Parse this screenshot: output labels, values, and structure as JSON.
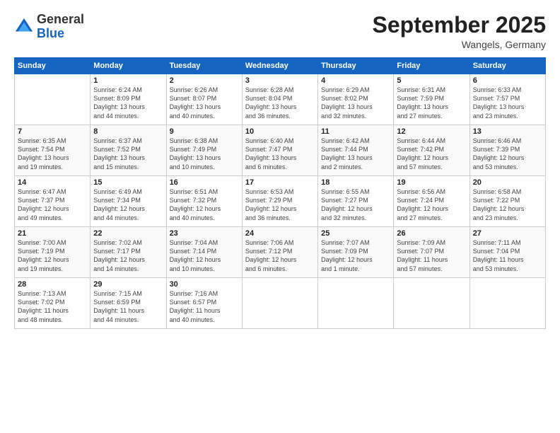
{
  "logo": {
    "line1": "General",
    "line2": "Blue"
  },
  "header": {
    "month": "September 2025",
    "location": "Wangels, Germany"
  },
  "days_of_week": [
    "Sunday",
    "Monday",
    "Tuesday",
    "Wednesday",
    "Thursday",
    "Friday",
    "Saturday"
  ],
  "weeks": [
    [
      {
        "day": "",
        "info": ""
      },
      {
        "day": "1",
        "info": "Sunrise: 6:24 AM\nSunset: 8:09 PM\nDaylight: 13 hours\nand 44 minutes."
      },
      {
        "day": "2",
        "info": "Sunrise: 6:26 AM\nSunset: 8:07 PM\nDaylight: 13 hours\nand 40 minutes."
      },
      {
        "day": "3",
        "info": "Sunrise: 6:28 AM\nSunset: 8:04 PM\nDaylight: 13 hours\nand 36 minutes."
      },
      {
        "day": "4",
        "info": "Sunrise: 6:29 AM\nSunset: 8:02 PM\nDaylight: 13 hours\nand 32 minutes."
      },
      {
        "day": "5",
        "info": "Sunrise: 6:31 AM\nSunset: 7:59 PM\nDaylight: 13 hours\nand 27 minutes."
      },
      {
        "day": "6",
        "info": "Sunrise: 6:33 AM\nSunset: 7:57 PM\nDaylight: 13 hours\nand 23 minutes."
      }
    ],
    [
      {
        "day": "7",
        "info": "Sunrise: 6:35 AM\nSunset: 7:54 PM\nDaylight: 13 hours\nand 19 minutes."
      },
      {
        "day": "8",
        "info": "Sunrise: 6:37 AM\nSunset: 7:52 PM\nDaylight: 13 hours\nand 15 minutes."
      },
      {
        "day": "9",
        "info": "Sunrise: 6:38 AM\nSunset: 7:49 PM\nDaylight: 13 hours\nand 10 minutes."
      },
      {
        "day": "10",
        "info": "Sunrise: 6:40 AM\nSunset: 7:47 PM\nDaylight: 13 hours\nand 6 minutes."
      },
      {
        "day": "11",
        "info": "Sunrise: 6:42 AM\nSunset: 7:44 PM\nDaylight: 13 hours\nand 2 minutes."
      },
      {
        "day": "12",
        "info": "Sunrise: 6:44 AM\nSunset: 7:42 PM\nDaylight: 12 hours\nand 57 minutes."
      },
      {
        "day": "13",
        "info": "Sunrise: 6:46 AM\nSunset: 7:39 PM\nDaylight: 12 hours\nand 53 minutes."
      }
    ],
    [
      {
        "day": "14",
        "info": "Sunrise: 6:47 AM\nSunset: 7:37 PM\nDaylight: 12 hours\nand 49 minutes."
      },
      {
        "day": "15",
        "info": "Sunrise: 6:49 AM\nSunset: 7:34 PM\nDaylight: 12 hours\nand 44 minutes."
      },
      {
        "day": "16",
        "info": "Sunrise: 6:51 AM\nSunset: 7:32 PM\nDaylight: 12 hours\nand 40 minutes."
      },
      {
        "day": "17",
        "info": "Sunrise: 6:53 AM\nSunset: 7:29 PM\nDaylight: 12 hours\nand 36 minutes."
      },
      {
        "day": "18",
        "info": "Sunrise: 6:55 AM\nSunset: 7:27 PM\nDaylight: 12 hours\nand 32 minutes."
      },
      {
        "day": "19",
        "info": "Sunrise: 6:56 AM\nSunset: 7:24 PM\nDaylight: 12 hours\nand 27 minutes."
      },
      {
        "day": "20",
        "info": "Sunrise: 6:58 AM\nSunset: 7:22 PM\nDaylight: 12 hours\nand 23 minutes."
      }
    ],
    [
      {
        "day": "21",
        "info": "Sunrise: 7:00 AM\nSunset: 7:19 PM\nDaylight: 12 hours\nand 19 minutes."
      },
      {
        "day": "22",
        "info": "Sunrise: 7:02 AM\nSunset: 7:17 PM\nDaylight: 12 hours\nand 14 minutes."
      },
      {
        "day": "23",
        "info": "Sunrise: 7:04 AM\nSunset: 7:14 PM\nDaylight: 12 hours\nand 10 minutes."
      },
      {
        "day": "24",
        "info": "Sunrise: 7:06 AM\nSunset: 7:12 PM\nDaylight: 12 hours\nand 6 minutes."
      },
      {
        "day": "25",
        "info": "Sunrise: 7:07 AM\nSunset: 7:09 PM\nDaylight: 12 hours\nand 1 minute."
      },
      {
        "day": "26",
        "info": "Sunrise: 7:09 AM\nSunset: 7:07 PM\nDaylight: 11 hours\nand 57 minutes."
      },
      {
        "day": "27",
        "info": "Sunrise: 7:11 AM\nSunset: 7:04 PM\nDaylight: 11 hours\nand 53 minutes."
      }
    ],
    [
      {
        "day": "28",
        "info": "Sunrise: 7:13 AM\nSunset: 7:02 PM\nDaylight: 11 hours\nand 48 minutes."
      },
      {
        "day": "29",
        "info": "Sunrise: 7:15 AM\nSunset: 6:59 PM\nDaylight: 11 hours\nand 44 minutes."
      },
      {
        "day": "30",
        "info": "Sunrise: 7:16 AM\nSunset: 6:57 PM\nDaylight: 11 hours\nand 40 minutes."
      },
      {
        "day": "",
        "info": ""
      },
      {
        "day": "",
        "info": ""
      },
      {
        "day": "",
        "info": ""
      },
      {
        "day": "",
        "info": ""
      }
    ]
  ]
}
